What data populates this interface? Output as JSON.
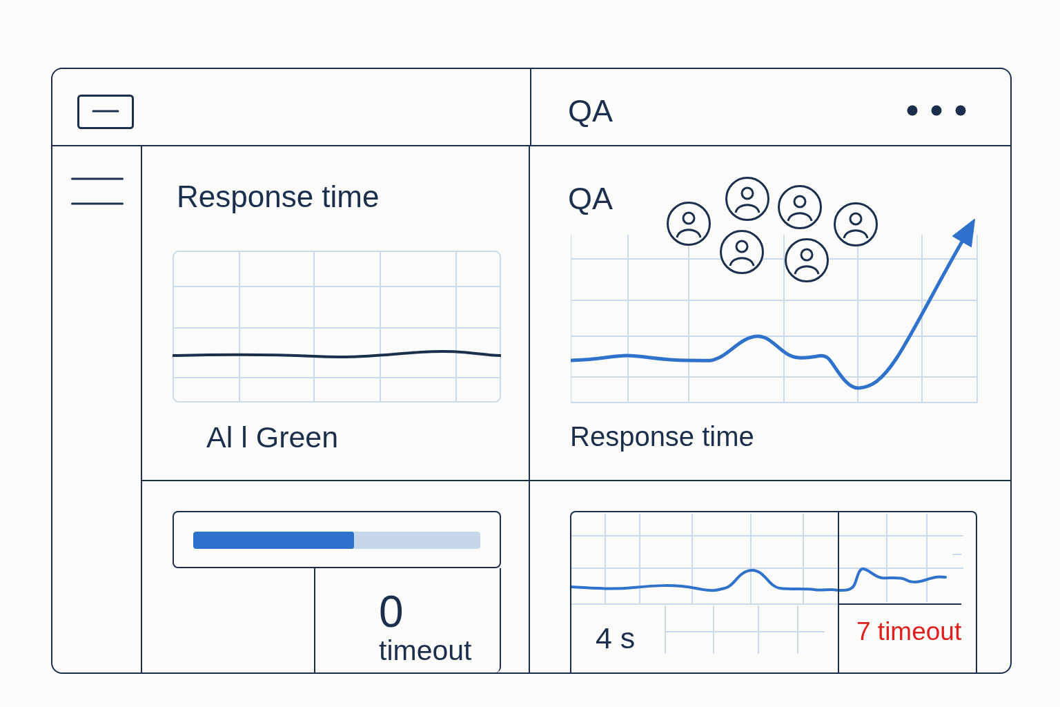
{
  "header": {
    "title": "QA"
  },
  "response_panel": {
    "title": "Response time",
    "caption": "Al l Green"
  },
  "qa_panel": {
    "title": "QA",
    "caption": "Response time"
  },
  "progress": {
    "level": 0.56
  },
  "timeout_stat": {
    "value": "0",
    "label": "timeout"
  },
  "latency_card": {
    "reading": "4 s",
    "alert": "7 timeout"
  }
}
